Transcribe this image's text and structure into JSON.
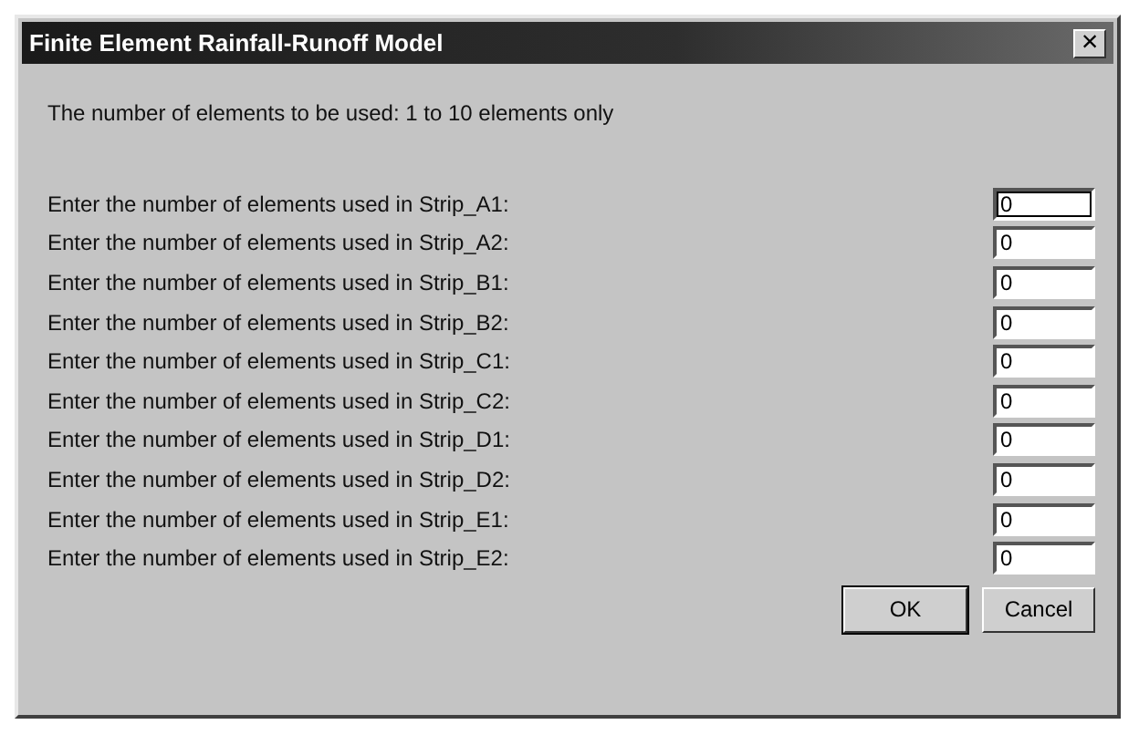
{
  "window": {
    "title": "Finite Element Rainfall-Runoff Model",
    "close": "×"
  },
  "intro": "The number of elements to be used: 1 to 10 elements only",
  "fields": [
    {
      "label": "Enter the number of elements used in Strip_A1:",
      "value": "0",
      "focused": true
    },
    {
      "label": "Enter the number of elements used in Strip_A2:",
      "value": "0",
      "focused": false
    },
    {
      "label": "Enter the number of elements used in Strip_B1:",
      "value": "0",
      "focused": false
    },
    {
      "label": "Enter the number of elements used in Strip_B2:",
      "value": "0",
      "focused": false
    },
    {
      "label": "Enter the number of elements used in Strip_C1:",
      "value": "0",
      "focused": false
    },
    {
      "label": "Enter the number of elements used in Strip_C2:",
      "value": "0",
      "focused": false
    },
    {
      "label": "Enter the number of elements used in Strip_D1:",
      "value": "0",
      "focused": false
    },
    {
      "label": "Enter the number of elements used in Strip_D2:",
      "value": "0",
      "focused": false
    },
    {
      "label": "Enter the number of elements used in Strip_E1:",
      "value": "0",
      "focused": false
    },
    {
      "label": "Enter the number of elements used in Strip_E2:",
      "value": "0",
      "focused": false
    }
  ],
  "buttons": [
    {
      "label": "OK",
      "default": true
    },
    {
      "label": "Cancel",
      "default": false
    }
  ]
}
